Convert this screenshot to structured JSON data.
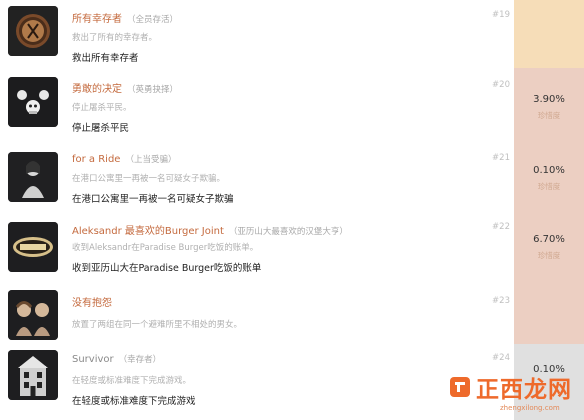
{
  "colors": {
    "side_peach": "#f6ddb8",
    "side_pink": "#eccfc2",
    "side_gray": "#e0e0e0",
    "row_bg": "#ffffff",
    "name_orange": "#c46a3e",
    "watermark": "#ee6a2b"
  },
  "achievements": [
    {
      "name": "所有幸存者",
      "sub": "（全员存活）",
      "desc_small": "救出了所有的幸存者。",
      "desc_cn": "救出所有幸存者",
      "number": "#19",
      "percent": "",
      "rarity": "",
      "icon": "coin-icon"
    },
    {
      "name": "勇敢的决定",
      "sub": "（英勇抉择）",
      "desc_small": "停止屠杀平民。",
      "desc_cn": "停止屠杀平民",
      "number": "#20",
      "percent": "3.90%",
      "rarity": "珍惜度",
      "icon": "skulls-icon"
    },
    {
      "name": "for a Ride",
      "sub": "（上当受骗）",
      "desc_small": "在港口公寓里一再被一名可疑女子欺骗。",
      "desc_cn": "在港口公寓里一再被一名可疑女子欺骗",
      "number": "#21",
      "percent": "0.10%",
      "rarity": "珍惜度",
      "icon": "woman-icon"
    },
    {
      "name": "Aleksandr 最喜欢的Burger Joint",
      "sub": "（亚历山大最喜欢的汉堡大亨）",
      "desc_small": "收到Aleksandr在Paradise Burger吃饭的账单。",
      "desc_cn": "收到亚历山大在Paradise Burger吃饭的账单",
      "number": "#22",
      "percent": "6.70%",
      "rarity": "珍惜度",
      "icon": "burger-sign-icon"
    },
    {
      "name": "没有抱怨",
      "sub": "",
      "desc_small": "放置了两组在同一个避难所里不相处的男女。",
      "desc_cn": "",
      "number": "#23",
      "percent": "",
      "rarity": "",
      "icon": "couple-icon"
    },
    {
      "name": "Survivor",
      "sub": "（幸存者）",
      "desc_small": "在轻度或标准难度下完成游戏。",
      "desc_cn": "在轻度或标准难度下完成游戏",
      "number": "#24",
      "percent": "0.10%",
      "rarity": "",
      "icon": "building-icon"
    }
  ],
  "watermark": {
    "text": "正西龙网",
    "url": "zhengxilong.com"
  }
}
